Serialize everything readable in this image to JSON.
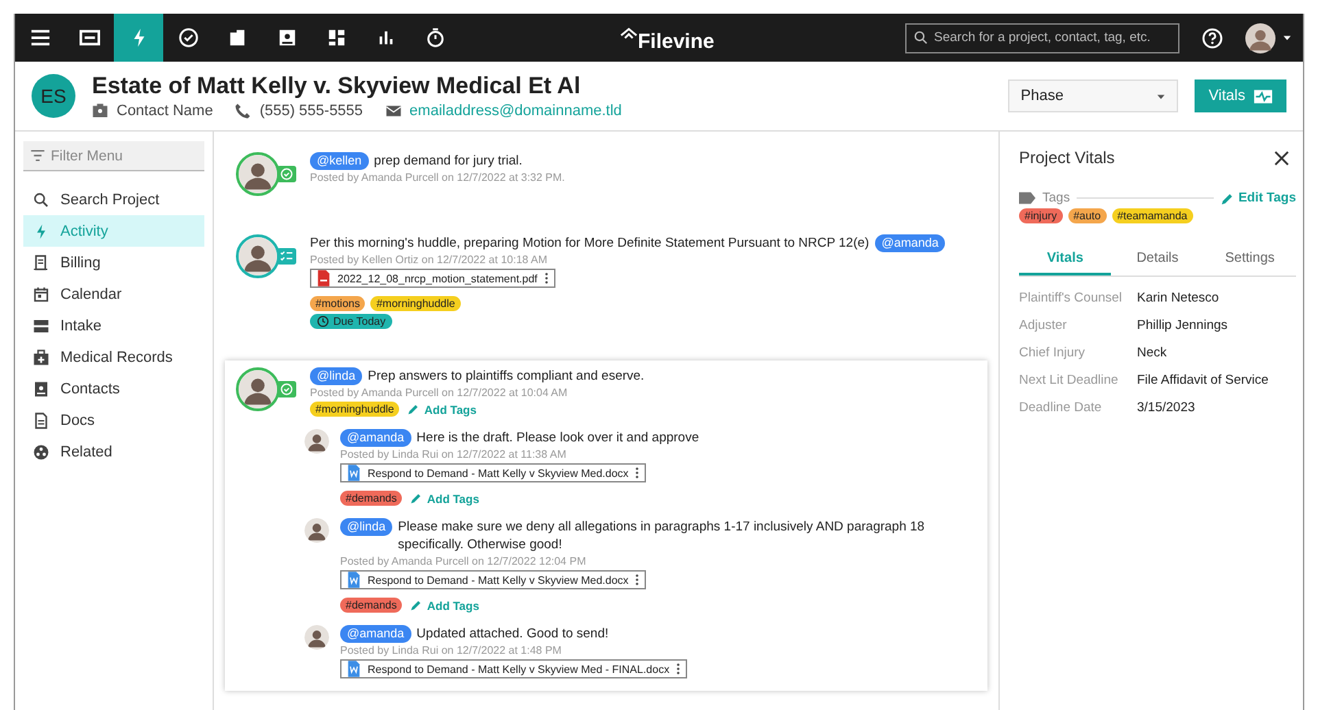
{
  "nav": {
    "icons": [
      {
        "kind": "menu",
        "selected": false
      },
      {
        "kind": "card",
        "selected": false
      },
      {
        "kind": "bolt",
        "selected": true
      },
      {
        "kind": "check",
        "selected": false
      },
      {
        "kind": "folder",
        "selected": false
      },
      {
        "kind": "contact",
        "selected": false
      },
      {
        "kind": "dashboard",
        "selected": false
      },
      {
        "kind": "chart",
        "selected": false
      },
      {
        "kind": "timer",
        "selected": false
      }
    ],
    "logo": "Filevine",
    "search": {
      "placeholder": "Search for a project, contact, tag, etc."
    }
  },
  "header": {
    "initials": "ES",
    "title": "Estate of Matt Kelly v. Skyview Medical Et Al",
    "contact": "Contact Name",
    "phone": "(555) 555-5555",
    "email": "emailaddress@domainname.tld",
    "phase": "Phase",
    "vitals_button": "Vitals"
  },
  "sidebar": {
    "filter_placeholder": "Filter Menu",
    "items": [
      {
        "label": "Search Project",
        "selected": false
      },
      {
        "label": "Activity",
        "selected": true
      },
      {
        "label": "Billing",
        "selected": false
      },
      {
        "label": "Calendar",
        "selected": false
      },
      {
        "label": "Intake",
        "selected": false
      },
      {
        "label": "Medical Records",
        "selected": false
      },
      {
        "label": "Contacts",
        "selected": false
      },
      {
        "label": "Docs",
        "selected": false
      },
      {
        "label": "Related",
        "selected": false
      }
    ]
  },
  "feed": {
    "posts": [
      {
        "kind": "check",
        "highlighted": false,
        "mention_before": "@kellen",
        "text": "prep demand for jury trial.",
        "meta": "Posted by Amanda Purcell on 12/7/2022 at 3:32 PM."
      },
      {
        "kind": "tasks",
        "highlighted": false,
        "text": "Per this morning's huddle, preparing Motion for More Definite Statement Pursuant to NRCP 12(e)",
        "mention_after": "@amanda",
        "meta": "Posted by Kellen Ortiz on 12/7/2022 at 10:18 AM",
        "attachments": [
          {
            "kind": "pdf",
            "name": "2022_12_08_nrcp_motion_statement.pdf"
          }
        ],
        "tags": [
          {
            "label": "#motions",
            "color": "#f4a64c"
          },
          {
            "label": "#morninghuddle",
            "color": "#f5cf1f"
          }
        ],
        "due": "Due Today"
      },
      {
        "kind": "check",
        "highlighted": true,
        "mention_before": "@linda",
        "text": "Prep answers to plaintiffs compliant and eserve.",
        "meta": "Posted by Amanda Purcell on 12/7/2022 at 10:04 AM",
        "tags": [
          {
            "label": "#morninghuddle",
            "color": "#f5cf1f"
          }
        ],
        "add_tags": "Add Tags",
        "replies": [
          {
            "mention": "@amanda",
            "text": "Here is the draft. Please look over it and approve",
            "meta": "Posted by Linda Rui on 12/7/2022 at 11:38 AM",
            "attachments": [
              {
                "kind": "doc",
                "name": "Respond to Demand - Matt Kelly v Skyview Med.docx"
              }
            ],
            "tags": [
              {
                "label": "#demands",
                "color": "#ef6a5a"
              }
            ],
            "add_tags": "Add Tags"
          },
          {
            "mention": "@linda",
            "text": "Please make sure we deny all allegations in paragraphs 1-17 inclusively AND paragraph 18 specifically. Otherwise good!",
            "meta": "Posted by Amanda Purcell on 12/7/2022 12:04 PM",
            "attachments": [
              {
                "kind": "doc",
                "name": "Respond to Demand - Matt Kelly v Skyview Med.docx"
              }
            ],
            "tags": [
              {
                "label": "#demands",
                "color": "#ef6a5a"
              }
            ],
            "add_tags": "Add Tags"
          },
          {
            "mention": "@amanda",
            "text": "Updated attached. Good to send!",
            "meta": "Posted by Linda Rui on 12/7/2022 at 1:48 PM",
            "attachments": [
              {
                "kind": "doc",
                "name": "Respond to Demand - Matt Kelly v Skyview Med - FINAL.docx"
              }
            ]
          }
        ]
      }
    ]
  },
  "vitals": {
    "title": "Project Vitals",
    "tags_label": "Tags",
    "edit_tags": "Edit Tags",
    "tags": [
      {
        "label": "#injury",
        "color": "#ef6a5a"
      },
      {
        "label": "#auto",
        "color": "#f4a64c"
      },
      {
        "label": "#teamamanda",
        "color": "#f5cf1f"
      }
    ],
    "tabs": [
      {
        "label": "Vitals",
        "selected": true
      },
      {
        "label": "Details",
        "selected": false
      },
      {
        "label": "Settings",
        "selected": false
      }
    ],
    "fields": [
      {
        "label": "Plaintiff's Counsel",
        "value": "Karin Netesco"
      },
      {
        "label": "Adjuster",
        "value": "Phillip Jennings"
      },
      {
        "label": "Chief Injury",
        "value": "Neck"
      },
      {
        "label": "Next Lit Deadline",
        "value": "File Affidavit of Service"
      },
      {
        "label": "Deadline Date",
        "value": "3/15/2023"
      }
    ]
  }
}
